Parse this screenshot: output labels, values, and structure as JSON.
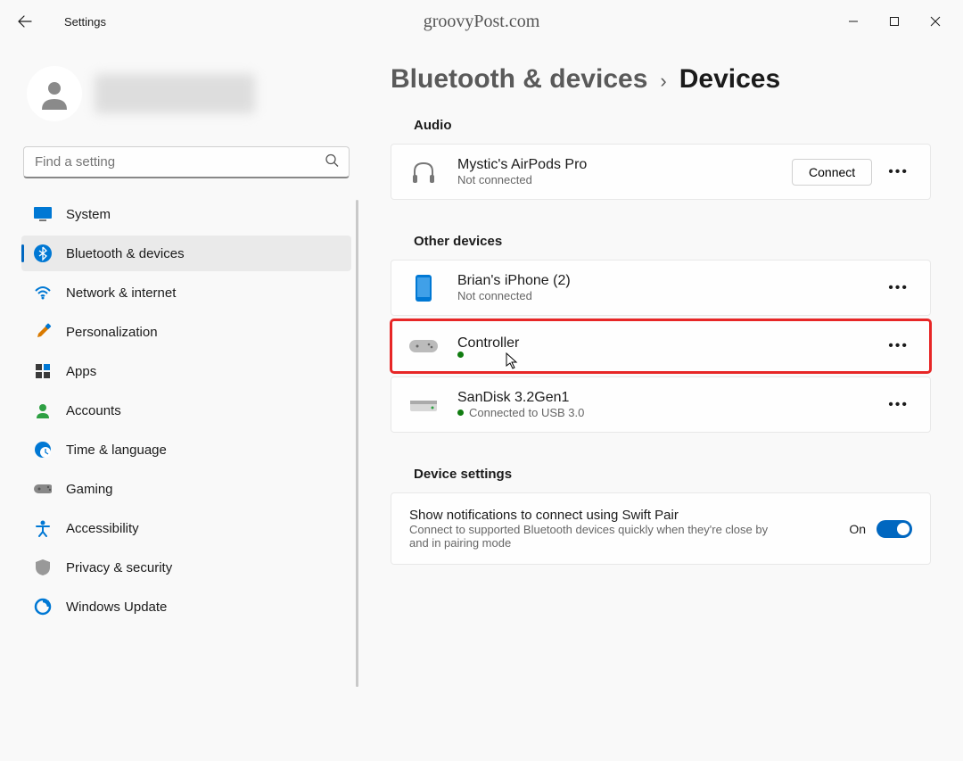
{
  "app": {
    "title": "Settings",
    "watermark": "groovyPost.com"
  },
  "search": {
    "placeholder": "Find a setting"
  },
  "nav": {
    "items": [
      {
        "label": "System"
      },
      {
        "label": "Bluetooth & devices"
      },
      {
        "label": "Network & internet"
      },
      {
        "label": "Personalization"
      },
      {
        "label": "Apps"
      },
      {
        "label": "Accounts"
      },
      {
        "label": "Time & language"
      },
      {
        "label": "Gaming"
      },
      {
        "label": "Accessibility"
      },
      {
        "label": "Privacy & security"
      },
      {
        "label": "Windows Update"
      }
    ]
  },
  "breadcrumb": {
    "parent": "Bluetooth & devices",
    "current": "Devices"
  },
  "sections": {
    "audio": {
      "title": "Audio",
      "device": {
        "name": "Mystic's AirPods Pro",
        "status": "Not connected",
        "action": "Connect"
      }
    },
    "other": {
      "title": "Other devices",
      "devices": [
        {
          "name": "Brian's iPhone (2)",
          "status": "Not connected",
          "connected": false
        },
        {
          "name": "Controller",
          "status": "",
          "connected": true
        },
        {
          "name": "SanDisk 3.2Gen1",
          "status": "Connected to USB 3.0",
          "connected": true
        }
      ]
    },
    "settings": {
      "title": "Device settings",
      "swiftpair": {
        "title": "Show notifications to connect using Swift Pair",
        "desc": "Connect to supported Bluetooth devices quickly when they're close by and in pairing mode",
        "state": "On"
      }
    }
  }
}
